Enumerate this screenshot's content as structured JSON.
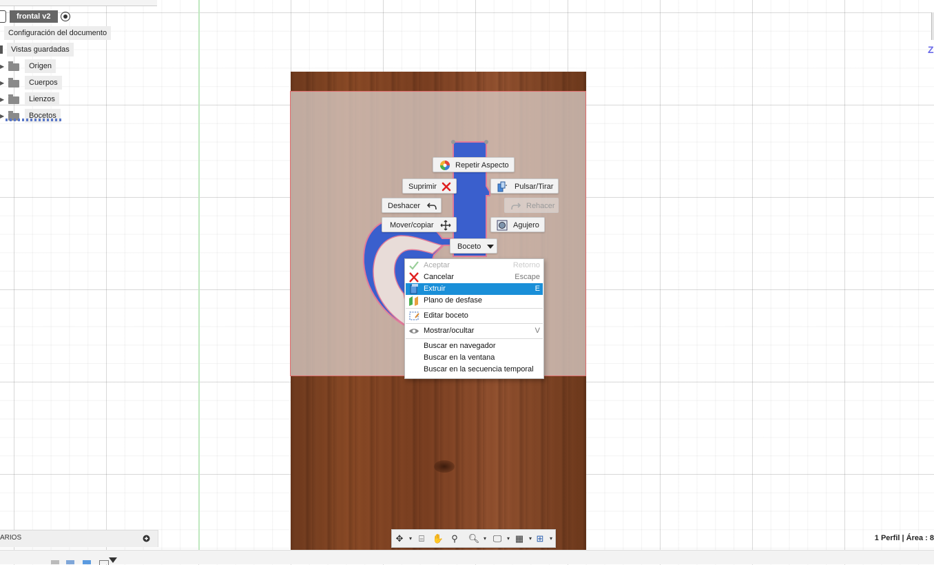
{
  "browser": {
    "root_label": "frontal v2",
    "items": [
      {
        "label": "Configuración del documento"
      },
      {
        "label": "Vistas guardadas"
      },
      {
        "label": "Origen"
      },
      {
        "label": "Cuerpos"
      },
      {
        "label": "Lienzos"
      },
      {
        "label": "Bocetos"
      }
    ]
  },
  "comments": {
    "label": "ARIOS"
  },
  "marking_menu": {
    "repeat": "Repetir Aspecto",
    "delete": "Suprimir",
    "press_pull": "Pulsar/Tirar",
    "undo": "Deshacer",
    "redo": "Rehacer",
    "move": "Mover/copiar",
    "hole": "Agujero",
    "sketch": "Boceto"
  },
  "context_menu": {
    "items": [
      {
        "label": "Aceptar",
        "shortcut": "Retorno",
        "disabled": true
      },
      {
        "label": "Cancelar",
        "shortcut": "Escape"
      },
      {
        "label": "Extruir",
        "shortcut": "E",
        "highlighted": true
      },
      {
        "label": "Plano de desfase",
        "shortcut": ""
      },
      {
        "label": "Editar boceto",
        "shortcut": ""
      },
      {
        "label": "Mostrar/ocultar",
        "shortcut": "V"
      },
      {
        "label": "Buscar en navegador",
        "shortcut": ""
      },
      {
        "label": "Buscar en la ventana",
        "shortcut": ""
      },
      {
        "label": "Buscar en la secuencia temporal",
        "shortcut": ""
      }
    ]
  },
  "status": {
    "selection": "1 Perfil | Área : 8"
  },
  "viewcube": {
    "letter": "Z"
  },
  "colors": {
    "highlight": "#1a8fd8",
    "profile": "#3a5fcd",
    "wood": "#8a4a26"
  }
}
